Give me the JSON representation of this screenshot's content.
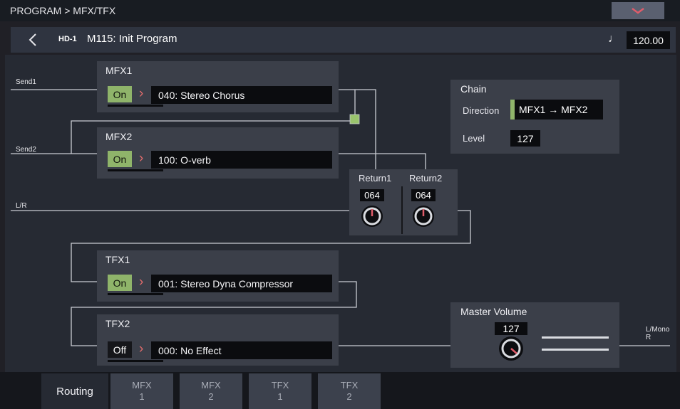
{
  "header": {
    "breadcrumb": "PROGRAM > MFX/TFX",
    "bank_badge": "HD-1",
    "program_name": "M115: Init Program",
    "tempo_symbol": "♩",
    "tempo": "120.00"
  },
  "routing": {
    "send1": "Send1",
    "send2": "Send2",
    "lr": "L/R",
    "out_line1": "L/Mono",
    "out_line2": "R"
  },
  "mfx1": {
    "title": "MFX1",
    "state": "On",
    "effect": "040: Stereo Chorus"
  },
  "mfx2": {
    "title": "MFX2",
    "state": "On",
    "effect": "100: O-verb"
  },
  "tfx1": {
    "title": "TFX1",
    "state": "On",
    "effect": "001: Stereo Dyna Compressor"
  },
  "tfx2": {
    "title": "TFX2",
    "state": "Off",
    "effect": "000: No Effect"
  },
  "returns": {
    "return1_label": "Return1",
    "return1_value": "064",
    "return2_label": "Return2",
    "return2_value": "064"
  },
  "chain": {
    "title": "Chain",
    "direction_label": "Direction",
    "direction_value": "MFX1 → MFX2",
    "level_label": "Level",
    "level_value": "127"
  },
  "master": {
    "title": "Master Volume",
    "value": "127"
  },
  "tabs": {
    "routing": "Routing",
    "items": [
      {
        "line1": "MFX",
        "line2": "1"
      },
      {
        "line1": "MFX",
        "line2": "2"
      },
      {
        "line1": "TFX",
        "line2": "1"
      },
      {
        "line1": "TFX",
        "line2": "2"
      }
    ]
  },
  "colors": {
    "on_green": "#8fb46a",
    "chevron_red": "#e06c6c",
    "panel": "#3b3f49",
    "background": "#262a33"
  },
  "icons": [
    "chevron-down-icon",
    "back-chevron-icon",
    "quarter-note-icon",
    "chevron-right-icon",
    "knob-icon"
  ]
}
